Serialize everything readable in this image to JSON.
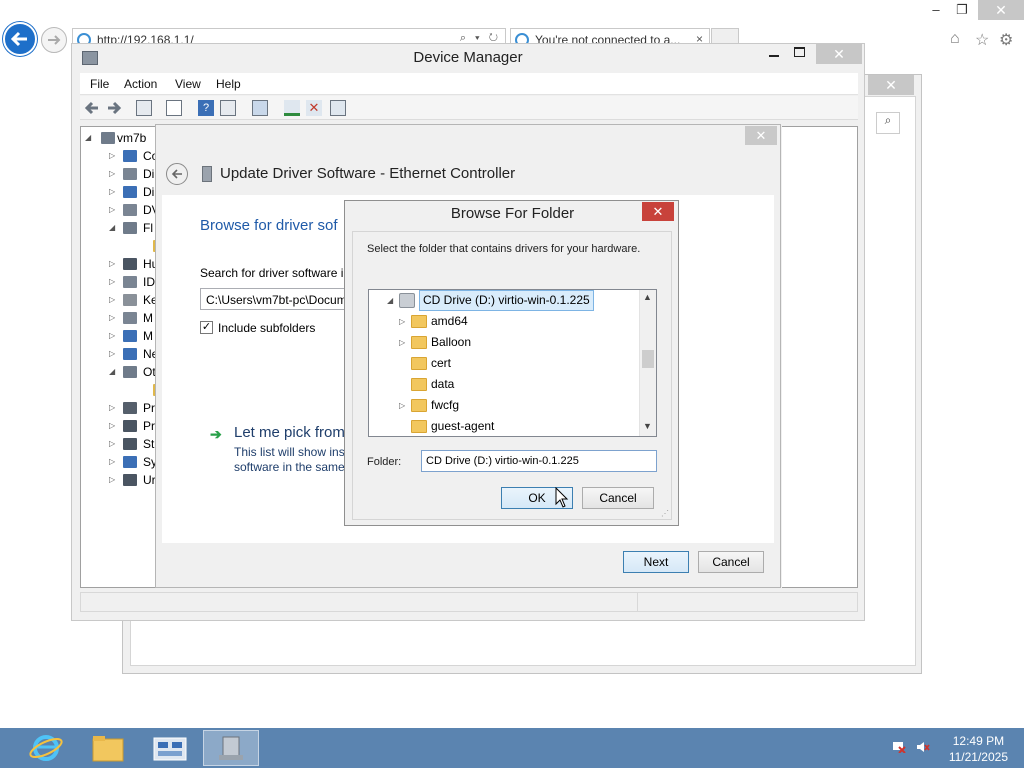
{
  "browser": {
    "address": "http://192.168.1.1/",
    "tab_title": "You're not connected to a..."
  },
  "device_manager": {
    "title": "Device Manager",
    "menu": [
      "File",
      "Action",
      "View",
      "Help"
    ],
    "tree": {
      "root": "vm7b",
      "items": [
        "Co",
        "Di",
        "Di",
        "DV",
        "Fl",
        "",
        "Hu",
        "ID",
        "Ke",
        "M",
        "M",
        "Ne",
        "Ot",
        "",
        "Pr",
        "Pr",
        "St",
        "Sy",
        "Ur"
      ]
    }
  },
  "update_driver": {
    "title": "Update Driver Software - Ethernet Controller",
    "heading": "Browse for driver sof",
    "search_label": "Search for driver software in",
    "path_value": "C:\\Users\\vm7bt-pc\\Docum",
    "include_subfolders": "Include subfolders",
    "pick_title": "Let me pick from",
    "pick_desc_line1": "This list will show inst",
    "pick_desc_line2": "software in the same",
    "next_label": "Next",
    "cancel_label": "Cancel"
  },
  "browse_folder": {
    "title": "Browse For Folder",
    "description": "Select the folder that contains drivers for your hardware.",
    "items": [
      {
        "label": "CD Drive (D:) virtio-win-0.1.225",
        "type": "drive",
        "selected": true
      },
      {
        "label": "amd64",
        "type": "folder",
        "expandable": true
      },
      {
        "label": "Balloon",
        "type": "folder",
        "expandable": true
      },
      {
        "label": "cert",
        "type": "folder",
        "expandable": false
      },
      {
        "label": "data",
        "type": "folder",
        "expandable": false
      },
      {
        "label": "fwcfg",
        "type": "folder",
        "expandable": true
      },
      {
        "label": "guest-agent",
        "type": "folder",
        "expandable": false
      }
    ],
    "folder_label": "Folder:",
    "folder_value": "CD Drive (D:) virtio-win-0.1.225",
    "ok_label": "OK",
    "cancel_label": "Cancel"
  },
  "taskbar": {
    "time": "12:49 PM",
    "date": "11/21/2025"
  },
  "colors": {
    "accent_blue": "#1f5aa8",
    "taskbar": "#5b84b0",
    "close_red": "#c8423b",
    "selection": "#d9ecfb"
  }
}
